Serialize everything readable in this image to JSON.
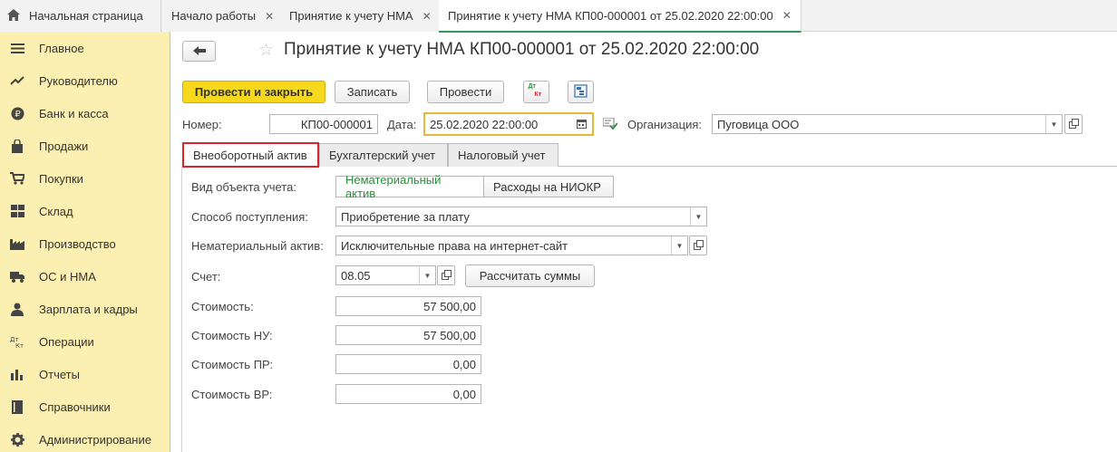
{
  "tabs": {
    "home": "Начальная страница",
    "items": [
      {
        "label": "Начало работы",
        "closable": true
      },
      {
        "label": "Принятие к учету НМА",
        "closable": true
      },
      {
        "label": "Принятие к учету НМА КП00-000001 от 25.02.2020 22:00:00",
        "closable": true,
        "active": true
      }
    ]
  },
  "sidebar": {
    "items": [
      {
        "label": "Главное",
        "icon": "menu-icon"
      },
      {
        "label": "Руководителю",
        "icon": "trend-icon"
      },
      {
        "label": "Банк и касса",
        "icon": "ruble-icon"
      },
      {
        "label": "Продажи",
        "icon": "bag-icon"
      },
      {
        "label": "Покупки",
        "icon": "cart-icon"
      },
      {
        "label": "Склад",
        "icon": "grid-icon"
      },
      {
        "label": "Производство",
        "icon": "factory-icon"
      },
      {
        "label": "ОС и НМА",
        "icon": "truck-icon"
      },
      {
        "label": "Зарплата и кадры",
        "icon": "person-icon"
      },
      {
        "label": "Операции",
        "icon": "dt-kt-icon"
      },
      {
        "label": "Отчеты",
        "icon": "bar-chart-icon"
      },
      {
        "label": "Справочники",
        "icon": "book-icon"
      },
      {
        "label": "Администрирование",
        "icon": "gear-icon"
      }
    ]
  },
  "doc": {
    "title": "Принятие к учету НМА КП00-000001 от 25.02.2020 22:00:00"
  },
  "toolbar": {
    "post_close": "Провести и закрыть",
    "save": "Записать",
    "post": "Провести",
    "dtkt_top": "Дт",
    "dtkt_bottom": "Кт"
  },
  "header": {
    "number_label": "Номер:",
    "number_value": "КП00-000001",
    "date_label": "Дата:",
    "date_value": "25.02.2020 22:00:00",
    "org_label": "Организация:",
    "org_value": "Пуговица ООО"
  },
  "form_tabs": [
    {
      "label": "Внеоборотный актив",
      "active": true
    },
    {
      "label": "Бухгалтерский учет"
    },
    {
      "label": "Налоговый учет"
    }
  ],
  "form": {
    "object_type_label": "Вид объекта учета:",
    "object_type_options": [
      "Нематериальный актив",
      "Расходы на НИОКР"
    ],
    "receipt_method_label": "Способ поступления:",
    "receipt_method_value": "Приобретение за плату",
    "asset_label": "Нематериальный актив:",
    "asset_value": "Исключительные права на интернет-сайт",
    "account_label": "Счет:",
    "account_value": "08.05",
    "calc_button": "Рассчитать суммы",
    "cost_label": "Стоимость:",
    "cost_value": "57 500,00",
    "cost_nu_label": "Стоимость НУ:",
    "cost_nu_value": "57 500,00",
    "cost_pr_label": "Стоимость ПР:",
    "cost_pr_value": "0,00",
    "cost_vr_label": "Стоимость ВР:",
    "cost_vr_value": "0,00"
  },
  "colors": {
    "sidebar_bg": "#fbf0b1",
    "primary_button": "#f6d91e",
    "active_tab_outline": "#d9262c",
    "selected_segment_text": "#2e8a3e"
  }
}
